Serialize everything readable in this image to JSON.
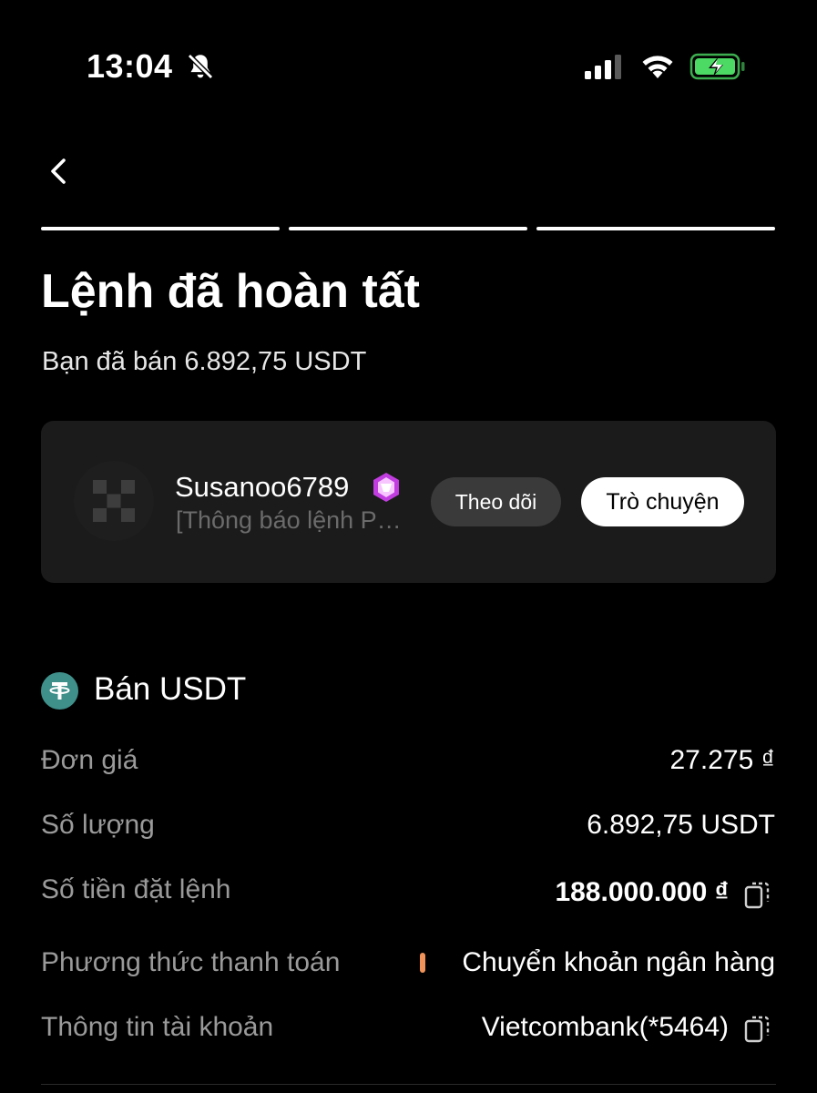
{
  "status_bar": {
    "time": "13:04",
    "battery_color": "#4cd964"
  },
  "progress": {
    "steps_total": 3,
    "steps_completed": 3
  },
  "header": {
    "title": "Lệnh đã hoàn tất",
    "subtitle": "Bạn đã bán 6.892,75 USDT"
  },
  "merchant": {
    "name": "Susanoo6789",
    "message_preview": "[Thông báo lệnh P…",
    "follow_label": "Theo dõi",
    "chat_label": "Trò chuyện",
    "badge_color": "#c23de0"
  },
  "order": {
    "section_title": "Bán USDT",
    "token_color": "#3f8f8a",
    "rows": [
      {
        "label": "Đơn giá",
        "value": "27.275 ₫"
      },
      {
        "label": "Số lượng",
        "value": "6.892,75 USDT"
      },
      {
        "label": "Số tiền đặt lệnh",
        "value": "188.000.000 ₫"
      },
      {
        "label": "Phương thức thanh toán",
        "value": "Chuyển khoản ngân hàng"
      },
      {
        "label": "Thông tin tài khoản",
        "value": "Vietcombank(*5464)"
      }
    ]
  }
}
